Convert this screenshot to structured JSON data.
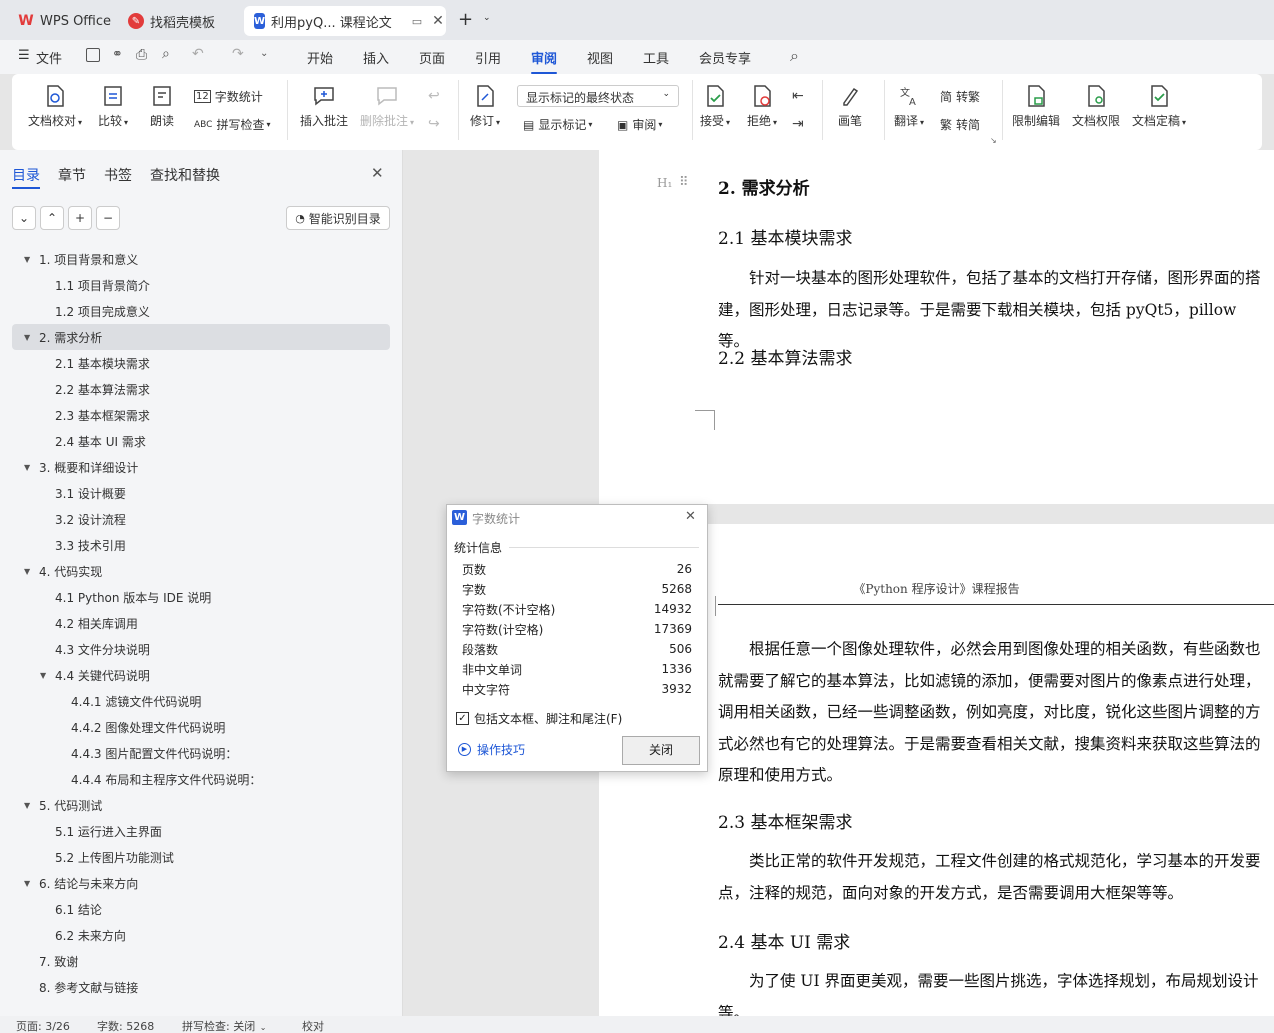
{
  "tabs": [
    {
      "label": "WPS Office"
    },
    {
      "label": "找稻壳模板"
    },
    {
      "label": "利用pyQ... 课程论文"
    }
  ],
  "menu": {
    "file": "文件",
    "items": [
      "开始",
      "插入",
      "页面",
      "引用",
      "审阅",
      "视图",
      "工具",
      "会员专享"
    ]
  },
  "ribbon": {
    "doc_check": "文档校对",
    "compare": "比较",
    "read_aloud": "朗读",
    "word_count": "字数统计",
    "spell_check": "拼写检查",
    "insert_comment": "插入批注",
    "delete_comment": "删除批注",
    "track_changes": "修订",
    "markup_state": "显示标记的最终状态",
    "show_markup": "显示标记",
    "review_pane": "审阅",
    "accept": "接受",
    "reject": "拒绝",
    "pen": "画笔",
    "translate": "翻译",
    "to_traditional": "转繁",
    "to_simplified": "转简",
    "restrict_edit": "限制编辑",
    "doc_permission": "文档权限",
    "finalize": "文档定稿"
  },
  "sidebar": {
    "tabs": [
      "目录",
      "章节",
      "书签",
      "查找和替换"
    ],
    "smart_toc": "智能识别目录",
    "toc": [
      {
        "label": "1.  项目背景和意义",
        "level": 1,
        "expanded": true,
        "selected": false
      },
      {
        "label": "1.1  项目背景简介",
        "level": 2,
        "expanded": null,
        "selected": false
      },
      {
        "label": "1.2  项目完成意义",
        "level": 2,
        "expanded": null,
        "selected": false
      },
      {
        "label": "2.  需求分析",
        "level": 1,
        "expanded": true,
        "selected": true
      },
      {
        "label": "2.1  基本模块需求",
        "level": 2,
        "expanded": null,
        "selected": false
      },
      {
        "label": "2.2  基本算法需求",
        "level": 2,
        "expanded": null,
        "selected": false
      },
      {
        "label": "2.3  基本框架需求",
        "level": 2,
        "expanded": null,
        "selected": false
      },
      {
        "label": "2.4  基本 UI 需求",
        "level": 2,
        "expanded": null,
        "selected": false
      },
      {
        "label": "3.  概要和详细设计",
        "level": 1,
        "expanded": true,
        "selected": false
      },
      {
        "label": "3.1  设计概要",
        "level": 2,
        "expanded": null,
        "selected": false
      },
      {
        "label": "3.2  设计流程",
        "level": 2,
        "expanded": null,
        "selected": false
      },
      {
        "label": "3.3  技术引用",
        "level": 2,
        "expanded": null,
        "selected": false
      },
      {
        "label": "4.  代码实现",
        "level": 1,
        "expanded": true,
        "selected": false
      },
      {
        "label": "4.1 Python 版本与 IDE 说明",
        "level": 2,
        "expanded": null,
        "selected": false
      },
      {
        "label": "4.2  相关库调用",
        "level": 2,
        "expanded": null,
        "selected": false
      },
      {
        "label": "4.3  文件分块说明",
        "level": 2,
        "expanded": null,
        "selected": false
      },
      {
        "label": "4.4  关键代码说明",
        "level": 2,
        "expanded": true,
        "selected": false
      },
      {
        "label": "4.4.1  滤镜文件代码说明",
        "level": 3,
        "expanded": null,
        "selected": false
      },
      {
        "label": "4.4.2  图像处理文件代码说明",
        "level": 3,
        "expanded": null,
        "selected": false
      },
      {
        "label": "4.4.3  图片配置文件代码说明：",
        "level": 3,
        "expanded": null,
        "selected": false
      },
      {
        "label": "4.4.4  布局和主程序文件代码说明：",
        "level": 3,
        "expanded": null,
        "selected": false
      },
      {
        "label": "5.  代码测试",
        "level": 1,
        "expanded": true,
        "selected": false
      },
      {
        "label": "5.1  运行进入主界面",
        "level": 2,
        "expanded": null,
        "selected": false
      },
      {
        "label": "5.2  上传图片功能测试",
        "level": 2,
        "expanded": null,
        "selected": false
      },
      {
        "label": "6.  结论与未来方向",
        "level": 1,
        "expanded": true,
        "selected": false
      },
      {
        "label": "6.1  结论",
        "level": 2,
        "expanded": null,
        "selected": false
      },
      {
        "label": "6.2  未来方向",
        "level": 2,
        "expanded": null,
        "selected": false
      },
      {
        "label": "7.  致谢",
        "level": 1,
        "expanded": null,
        "selected": false
      },
      {
        "label": "8.  参考文献与链接",
        "level": 1,
        "expanded": null,
        "selected": false
      }
    ]
  },
  "document": {
    "h1": "2.  需求分析",
    "h1_marker": "H₁",
    "h2_1": "2.1  基本模块需求",
    "p1": "针对一块基本的图形处理软件，包括了基本的文档打开存储，图形界面的搭建，图形处理，日志记录等。于是需要下载相关模块，包括 pyQt5，pillow 等。",
    "h2_2": "2.2  基本算法需求",
    "header": "《Python 程序设计》课程报告",
    "p2": "根据任意一个图像处理软件，必然会用到图像处理的相关函数，有些函数也就需要了解它的基本算法，比如滤镜的添加，便需要对图片的像素点进行处理，调用相关函数，已经一些调整函数，例如亮度，对比度，锐化这些图片调整的方式必然也有它的处理算法。于是需要查看相关文献，搜集资料来获取这些算法的原理和使用方式。",
    "h2_3": "2.3  基本框架需求",
    "p3": "类比正常的软件开发规范，工程文件创建的格式规范化，学习基本的开发要点，注释的规范，面向对象的开发方式，是否需要调用大框架等等。",
    "h2_4": "2.4  基本 UI 需求",
    "p4": "为了使 UI 界面更美观，需要一些图片挑选，字体选择规划，布局规划设计等。"
  },
  "dialog": {
    "title": "字数统计",
    "section": "统计信息",
    "rows": [
      {
        "label": "页数",
        "value": "26"
      },
      {
        "label": "字数",
        "value": "5268"
      },
      {
        "label": "字符数(不计空格)",
        "value": "14932"
      },
      {
        "label": "字符数(计空格)",
        "value": "17369"
      },
      {
        "label": "段落数",
        "value": "506"
      },
      {
        "label": "非中文单词",
        "value": "1336"
      },
      {
        "label": "中文字符",
        "value": "3932"
      }
    ],
    "checkbox_label": "包括文本框、脚注和尾注(F)",
    "tips": "操作技巧",
    "close": "关闭"
  },
  "status": {
    "page": "页面: 3/26",
    "words": "字数: 5268",
    "spell": "拼写检查: 关闭",
    "proof": "校对"
  },
  "colors": {
    "accent": "#1e57d6",
    "wps_red": "#e23b3b",
    "doc_blue": "#2b5fd9"
  }
}
